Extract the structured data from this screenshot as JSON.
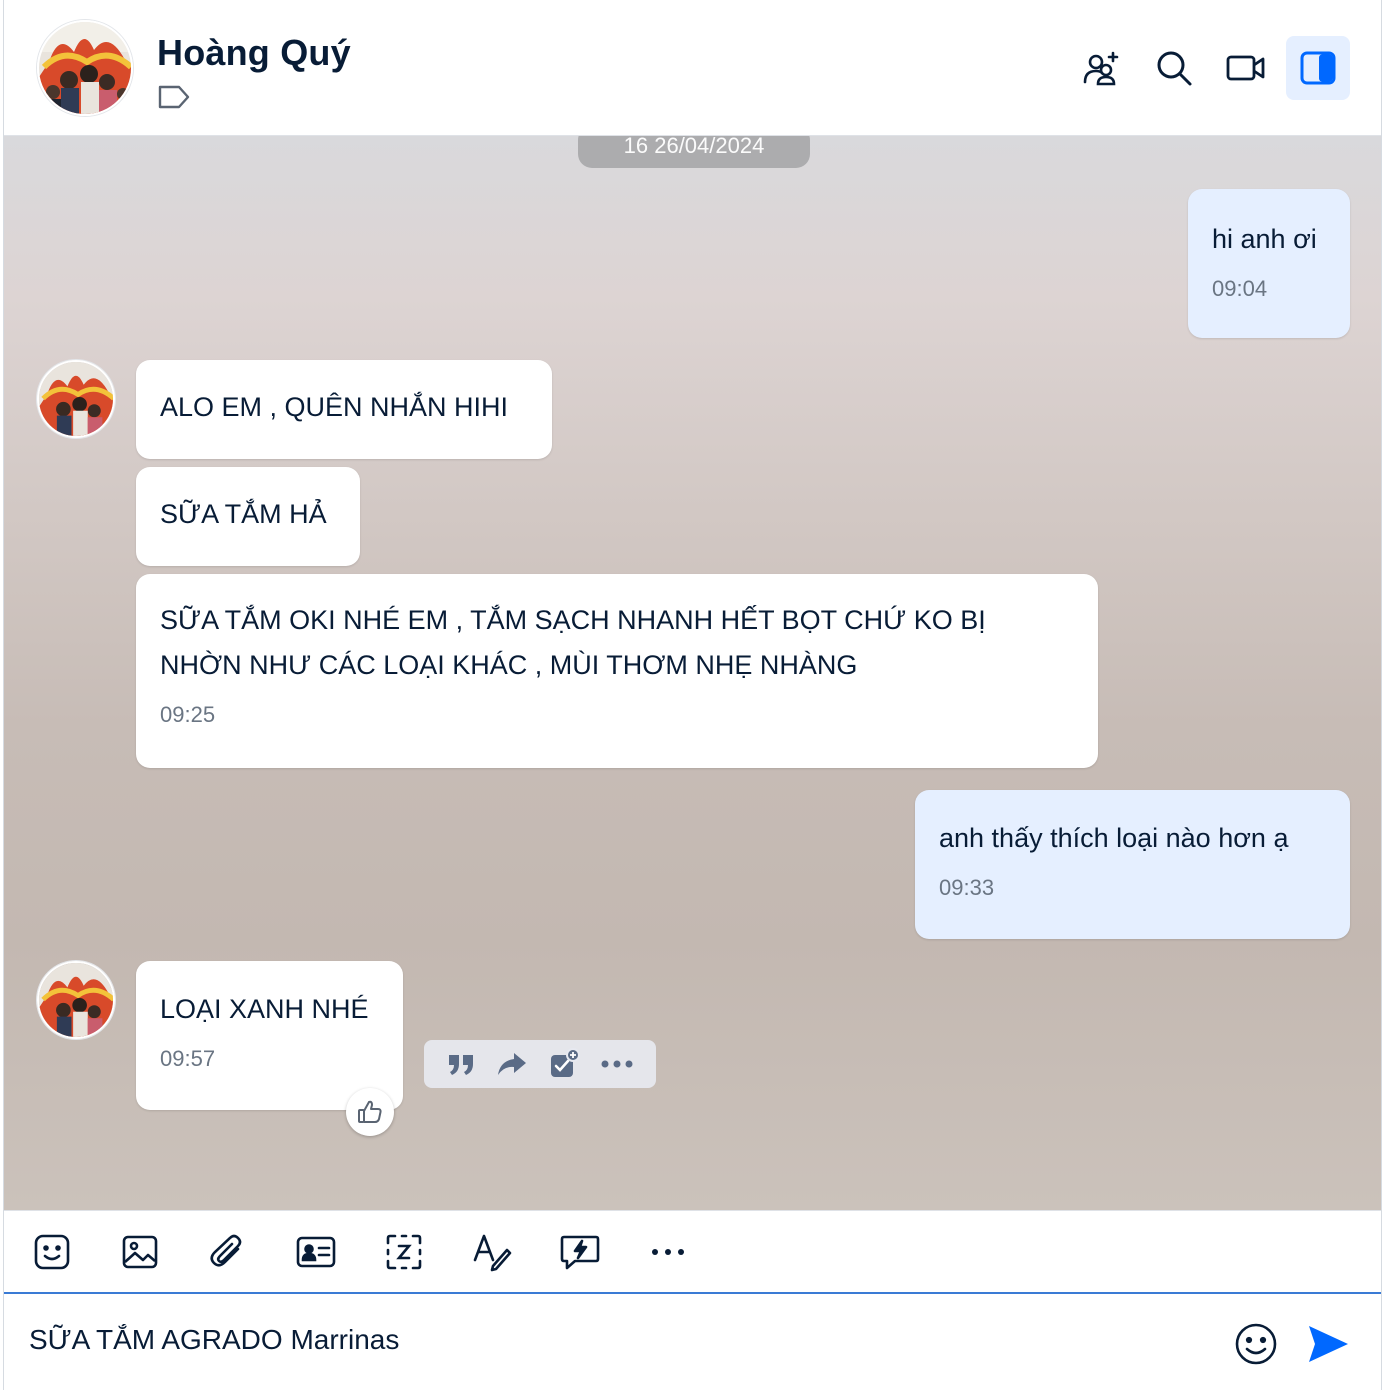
{
  "header": {
    "contact_name": "Hoàng Quý",
    "icons": [
      "add-member-icon",
      "search-icon",
      "video-call-icon",
      "sidebar-toggle-icon"
    ]
  },
  "chat": {
    "date_separator": "16 26/04/2024",
    "messages": [
      {
        "sender": "me",
        "text": "hi anh ơi",
        "time": "09:04"
      },
      {
        "sender": "contact",
        "text": "ALO EM , QUÊN NHẮN HIHI",
        "time": ""
      },
      {
        "sender": "contact",
        "text": "SỮA TẮM HẢ",
        "time": ""
      },
      {
        "sender": "contact",
        "text_line1": "SỮA TẮM OKI NHÉ EM , TẮM SẠCH NHANH HẾT BỌT CHỨ KO BỊ",
        "text_line2": "NHỜN NHƯ CÁC LOẠI KHÁC , MÙI THƠM NHẸ NHÀNG",
        "time": "09:25"
      },
      {
        "sender": "me",
        "text": "anh thấy thích loại nào hơn ạ",
        "time": "09:33"
      },
      {
        "sender": "contact",
        "text": "LOẠI XANH NHÉ",
        "time": "09:57"
      }
    ],
    "hover_actions": [
      "quote-icon",
      "forward-icon",
      "add-task-icon",
      "more-icon"
    ],
    "reaction_icon": "thumbs-up-icon"
  },
  "toolbar": {
    "icons": [
      "sticker-icon",
      "image-icon",
      "attach-icon",
      "contact-card-icon",
      "screenshot-icon",
      "format-text-icon",
      "quick-message-icon",
      "more-icon"
    ]
  },
  "composer": {
    "input_value": "SỮA TẮM AGRADO Marrinas",
    "emoji_icon": "emoji-icon",
    "send_icon": "send-icon"
  },
  "colors": {
    "accent": "#0068ff",
    "my_bubble": "#e5efff",
    "their_bubble": "#ffffff",
    "text": "#081c36",
    "time_text": "#6a7583"
  }
}
